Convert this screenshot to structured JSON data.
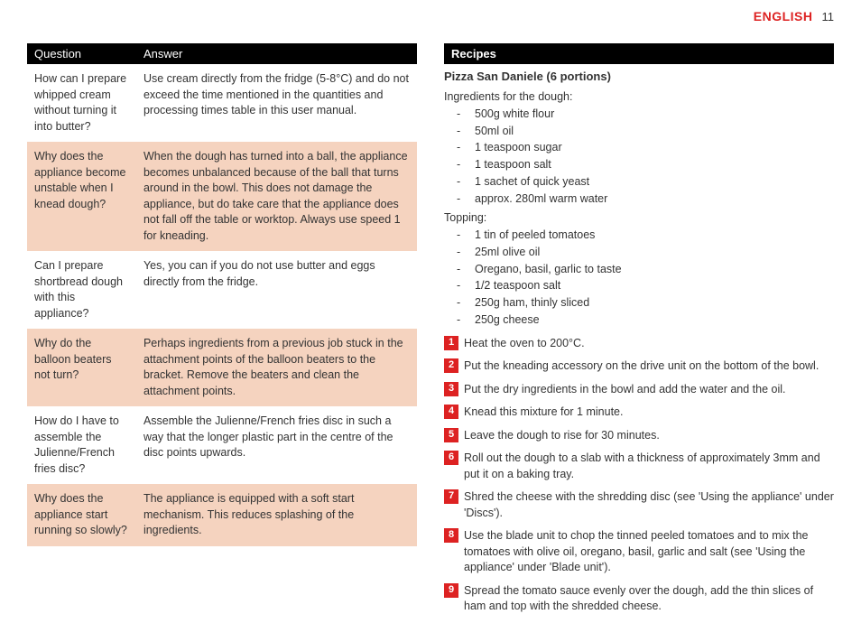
{
  "header": {
    "language": "ENGLISH",
    "pageNumber": "11"
  },
  "qa": {
    "columns": {
      "q": "Question",
      "a": "Answer"
    },
    "rows": [
      {
        "q": "How can I prepare whipped cream without turning it into butter?",
        "a": "Use cream directly from the fridge (5-8°C) and do not exceed the time mentioned in the quantities and processing times table in this user manual."
      },
      {
        "q": "Why does the appliance become unstable when I knead dough?",
        "a": "When the dough has turned into a ball, the appliance becomes unbalanced because of the ball that turns around in the bowl. This does not damage the appliance, but do take care that the appliance does not fall off the table or worktop. Always use speed 1 for kneading."
      },
      {
        "q": "Can I prepare shortbread dough with this appliance?",
        "a": "Yes, you can if you do not use butter and eggs directly from the fridge."
      },
      {
        "q": "Why do the balloon beaters not turn?",
        "a": "Perhaps ingredients from a previous job stuck in the attachment points of the balloon beaters to the bracket. Remove the beaters and clean the attachment points."
      },
      {
        "q": "How do I have to assemble the Julienne/French fries disc?",
        "a": "Assemble the Julienne/French fries disc in such a way that the longer plastic part in the centre of the disc points upwards."
      },
      {
        "q": "Why does the appliance start running so slowly?",
        "a": "The appliance is equipped with a soft start mechanism. This reduces splashing of the ingredients."
      }
    ]
  },
  "recipes": {
    "sectionTitle": "Recipes",
    "title": "Pizza San Daniele (6 portions)",
    "doughHeading": "Ingredients for the dough:",
    "doughItems": [
      "500g white flour",
      "50ml oil",
      "1 teaspoon sugar",
      "1 teaspoon salt",
      "1 sachet of quick yeast",
      "approx. 280ml warm water"
    ],
    "toppingHeading": "Topping:",
    "toppingItems": [
      "1 tin of peeled tomatoes",
      "25ml olive oil",
      "Oregano, basil, garlic to taste",
      "1/2  teaspoon salt",
      "250g ham, thinly sliced",
      "250g cheese"
    ],
    "steps": [
      "Heat the oven to 200°C.",
      "Put the kneading accessory on the drive unit on the bottom of the bowl.",
      "Put the dry ingredients in the bowl and add the water and the oil.",
      "Knead this mixture for 1 minute.",
      "Leave the dough to rise for 30 minutes.",
      "Roll out the dough to a slab with a thickness of approximately 3mm and put it on a baking tray.",
      "Shred the cheese with the shredding disc (see 'Using the appliance' under 'Discs').",
      "Use the blade unit to chop the tinned peeled tomatoes and to mix the tomatoes with olive oil, oregano, basil, garlic and salt (see 'Using the appliance' under 'Blade unit').",
      "Spread the tomato sauce evenly over the dough, add the thin slices of ham and top with the shredded cheese."
    ]
  }
}
